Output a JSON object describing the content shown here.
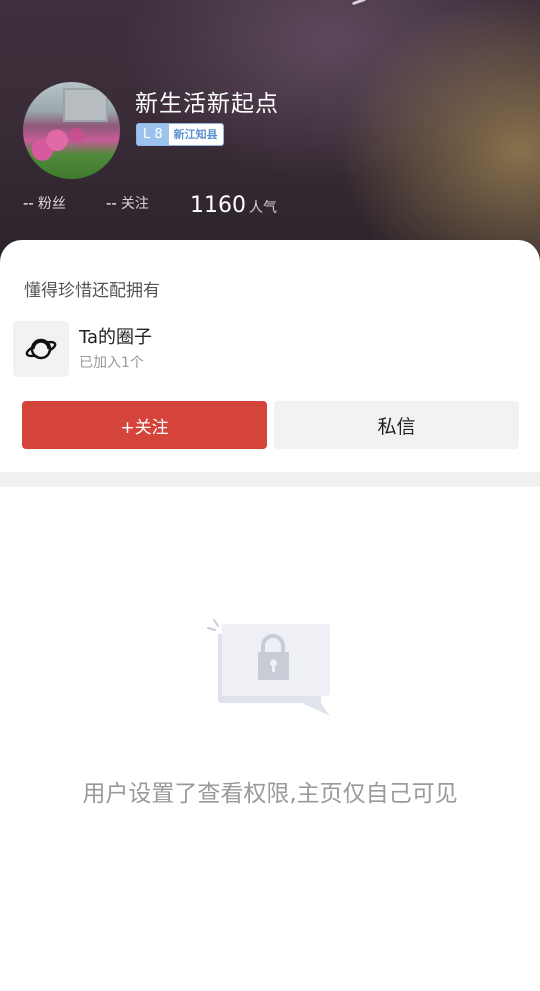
{
  "profile": {
    "username": "新生活新起点",
    "badge": {
      "level": "L 8",
      "title": "新江知县"
    },
    "stats": [
      {
        "value": "--",
        "label": "粉丝"
      },
      {
        "value": "--",
        "label": "关注"
      },
      {
        "value": "1160",
        "label": "人气"
      }
    ]
  },
  "card": {
    "motto": "懂得珍惜还配拥有",
    "circle": {
      "icon": "planet-icon",
      "title": "Ta的圈子",
      "subtitle": "已加入1个"
    },
    "buttons": {
      "follow": "+关注",
      "message": "私信"
    }
  },
  "empty_state": {
    "icon": "lock-icon",
    "message": "用户设置了查看权限,主页仅自己可见"
  },
  "colors": {
    "follow_button": "#d5443b",
    "badge_blue": "#9cc2ee"
  }
}
